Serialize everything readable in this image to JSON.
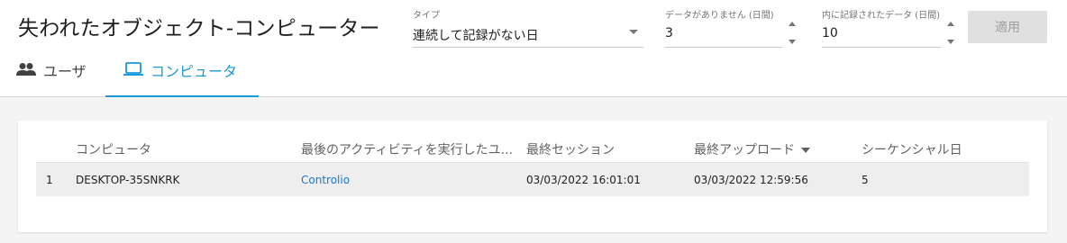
{
  "title": "失われたオブジェクト-コンピューター",
  "filters": {
    "type": {
      "label": "タイプ",
      "value": "連続して記録がない日"
    },
    "no_data_days": {
      "label": "データがありません (日間)",
      "value": "3"
    },
    "records_within": {
      "label": "内に記録されたデータ (日間)",
      "value": "10"
    },
    "apply_label": "適用"
  },
  "tabs": [
    {
      "label": "ユーザ",
      "icon": "users-icon",
      "active": false
    },
    {
      "label": "コンピュータ",
      "icon": "laptop-icon",
      "active": true
    }
  ],
  "table": {
    "columns": [
      "コンピュータ",
      "最後のアクティビティを実行したユ...",
      "最終セッション",
      "最終アップロード",
      "シーケンシャル日"
    ],
    "sorted_column": "最終アップロード",
    "rows": [
      {
        "index": "1",
        "computer": "DESKTOP-35SNKRK",
        "last_user": "Controlio",
        "last_session": "03/03/2022 16:01:01",
        "last_upload": "03/03/2022 12:59:56",
        "sequential_days": "5"
      }
    ]
  },
  "colors": {
    "accent": "#1a9bd7",
    "link": "#1976d2",
    "disabled_button": "#e0e0e0"
  }
}
